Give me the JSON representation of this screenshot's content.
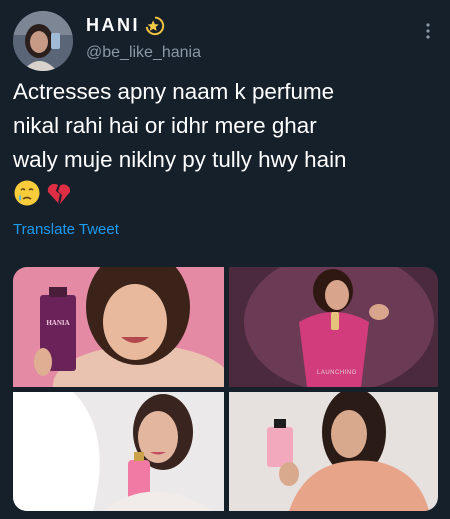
{
  "user": {
    "display_name": "HANI",
    "handle": "@be_like_hania",
    "avatar_icon": "profile-avatar",
    "badge_icon": "dizzy-star-emoji"
  },
  "tweet": {
    "text": "Actresses apny naam k perfume\nnikal rahi hai or idhr mere ghar\nwaly muje niklny py tully hwy hain",
    "emojis": [
      "crying-face-emoji",
      "broken-heart-emoji"
    ],
    "translate_label": "Translate Tweet"
  },
  "media": {
    "photo_2_caption": "LAUNCHING",
    "photos": [
      "perfume-promo-photo-1",
      "perfume-promo-photo-2",
      "perfume-promo-photo-3",
      "perfume-promo-photo-4"
    ]
  },
  "colors": {
    "background": "#15202b",
    "text": "#ffffff",
    "secondary_text": "#8b98a5",
    "link": "#1d9bf0"
  }
}
